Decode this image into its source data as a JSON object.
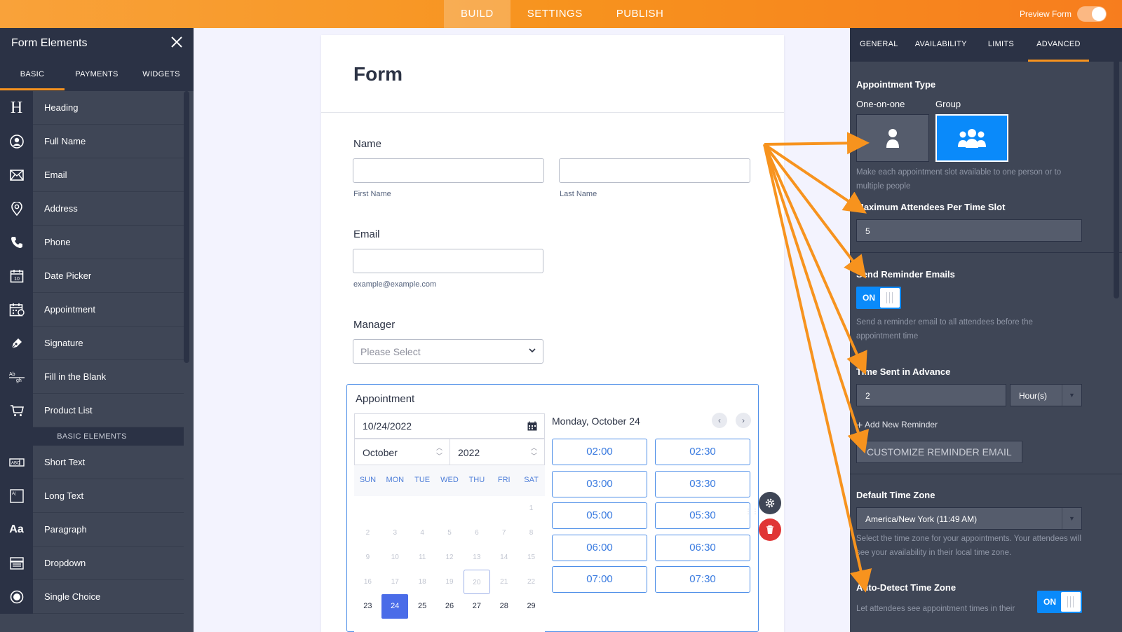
{
  "topbar": {
    "tabs": [
      {
        "label": "BUILD"
      },
      {
        "label": "SETTINGS"
      },
      {
        "label": "PUBLISH"
      }
    ],
    "active_tab": "BUILD",
    "preview_label": "Preview Form"
  },
  "left_panel": {
    "title": "Form Elements",
    "tabs": [
      {
        "label": "BASIC"
      },
      {
        "label": "PAYMENTS"
      },
      {
        "label": "WIDGETS"
      }
    ],
    "items": [
      {
        "label": "Heading",
        "icon": "heading-icon"
      },
      {
        "label": "Full Name",
        "icon": "user-circle-icon"
      },
      {
        "label": "Email",
        "icon": "envelope-icon"
      },
      {
        "label": "Address",
        "icon": "map-pin-icon"
      },
      {
        "label": "Phone",
        "icon": "phone-icon"
      },
      {
        "label": "Date Picker",
        "icon": "calendar-icon"
      },
      {
        "label": "Appointment",
        "icon": "calendar-clock-icon"
      },
      {
        "label": "Signature",
        "icon": "pen-icon"
      },
      {
        "label": "Fill in the Blank",
        "icon": "fill-blank-icon"
      },
      {
        "label": "Product List",
        "icon": "cart-icon"
      }
    ],
    "section_label": "BASIC ELEMENTS",
    "basic_items": [
      {
        "label": "Short Text",
        "icon": "short-text-icon"
      },
      {
        "label": "Long Text",
        "icon": "long-text-icon"
      },
      {
        "label": "Paragraph",
        "icon": "paragraph-icon"
      },
      {
        "label": "Dropdown",
        "icon": "dropdown-icon"
      },
      {
        "label": "Single Choice",
        "icon": "radio-icon"
      }
    ]
  },
  "form": {
    "title": "Form",
    "name": {
      "label": "Name",
      "first_sub": "First Name",
      "last_sub": "Last Name"
    },
    "email": {
      "label": "Email",
      "sub": "example@example.com"
    },
    "manager": {
      "label": "Manager",
      "placeholder": "Please Select"
    },
    "appointment": {
      "label": "Appointment",
      "date_value": "10/24/2022",
      "month": "October",
      "year": "2022",
      "weekdays": [
        "SUN",
        "MON",
        "TUE",
        "WED",
        "THU",
        "FRI",
        "SAT"
      ],
      "weeks": [
        [
          "",
          "",
          "",
          "",
          "",
          "",
          "1"
        ],
        [
          "2",
          "3",
          "4",
          "5",
          "6",
          "7",
          "8"
        ],
        [
          "9",
          "10",
          "11",
          "12",
          "13",
          "14",
          "15"
        ],
        [
          "16",
          "17",
          "18",
          "19",
          "20",
          "21",
          "22"
        ],
        [
          "23",
          "24",
          "25",
          "26",
          "27",
          "28",
          "29"
        ]
      ],
      "today": "20",
      "selected": "24",
      "schedule_date": "Monday, October 24",
      "slots": [
        "02:00",
        "02:30",
        "03:00",
        "03:30",
        "05:00",
        "05:30",
        "06:00",
        "06:30",
        "07:00",
        "07:30"
      ]
    }
  },
  "right_panel": {
    "tabs": [
      {
        "label": "GENERAL"
      },
      {
        "label": "AVAILABILITY"
      },
      {
        "label": "LIMITS"
      },
      {
        "label": "ADVANCED"
      }
    ],
    "active_tab": "ADVANCED",
    "appointment_type": {
      "title": "Appointment Type",
      "option_one": "One-on-one",
      "option_group": "Group",
      "selected": "Group",
      "help": "Make each appointment slot available to one person or to multiple people"
    },
    "max_attendees": {
      "title": "Maximum Attendees Per Time Slot",
      "value": "5"
    },
    "reminder": {
      "title": "Send Reminder Emails",
      "toggle": "ON",
      "help": "Send a reminder email to all attendees before the appointment time"
    },
    "time_sent": {
      "title": "Time Sent in Advance",
      "value": "2",
      "unit": "Hour(s)"
    },
    "add_reminder": "Add New Reminder",
    "customize_button": "CUSTOMIZE REMINDER EMAIL",
    "timezone": {
      "title": "Default Time Zone",
      "value": "America/New York (11:49 AM)",
      "help": "Select the time zone for your appointments. Your attendees will see your availability in their local time zone."
    },
    "auto_detect": {
      "title": "Auto-Detect Time Zone",
      "toggle": "ON",
      "help": "Let attendees see appointment times in their"
    }
  },
  "colors": {
    "topbar": "#f7931e",
    "panel_dark": "#2b3245",
    "panel": "#3f4656",
    "accent_blue": "#0a8afa",
    "arrow": "#f7931e",
    "delete_red": "#e03636"
  }
}
